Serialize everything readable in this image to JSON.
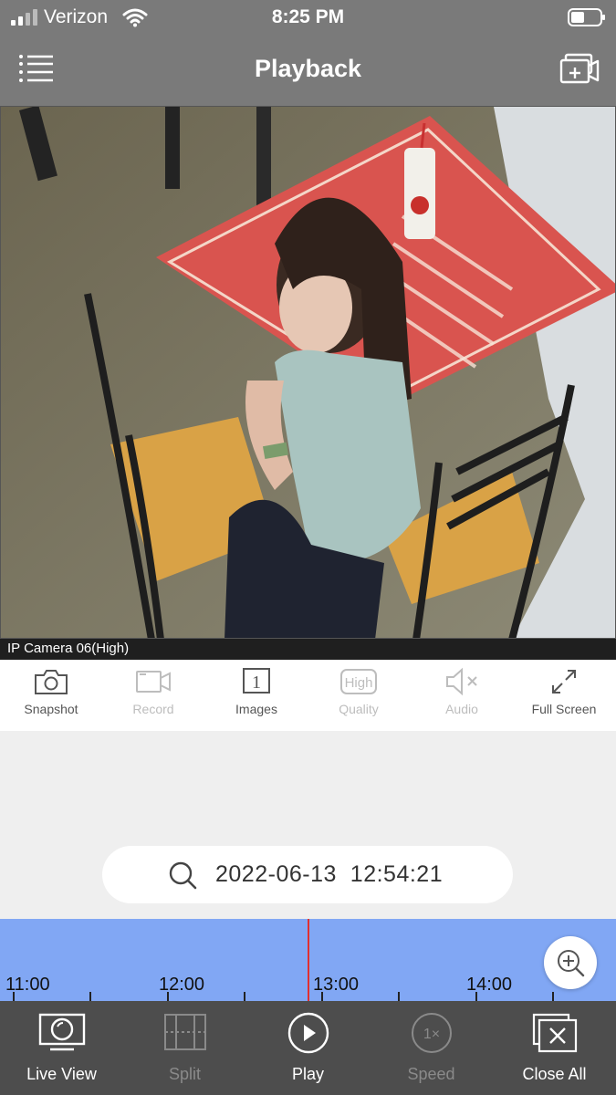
{
  "status_bar": {
    "carrier": "Verizon",
    "time": "8:25 PM"
  },
  "header": {
    "title": "Playback",
    "left_icon": "menu-icon",
    "right_icon": "add-camera-icon"
  },
  "video": {
    "camera_label": "IP Camera 06(High)"
  },
  "toolbar": {
    "items": [
      {
        "label": "Snapshot",
        "icon": "camera-icon",
        "enabled": true
      },
      {
        "label": "Record",
        "icon": "video-record-icon",
        "enabled": false
      },
      {
        "label": "Images",
        "icon": "images-icon",
        "badge": "1",
        "enabled": true
      },
      {
        "label": "Quality",
        "icon": "quality-icon",
        "badge": "High",
        "enabled": false
      },
      {
        "label": "Audio",
        "icon": "audio-muted-icon",
        "enabled": false
      },
      {
        "label": "Full Screen",
        "icon": "fullscreen-icon",
        "enabled": true
      }
    ]
  },
  "search": {
    "date": "2022-06-13",
    "time": "12:54:21"
  },
  "timeline": {
    "labels": [
      "11:00",
      "12:00",
      "13:00",
      "14:00"
    ],
    "playhead_time": "12:54:21"
  },
  "bottom_bar": {
    "items": [
      {
        "label": "Live View",
        "icon": "live-view-icon",
        "enabled": true
      },
      {
        "label": "Split",
        "icon": "split-icon",
        "enabled": false
      },
      {
        "label": "Play",
        "icon": "play-icon",
        "enabled": true
      },
      {
        "label": "Speed",
        "icon": "speed-icon",
        "badge": "1×",
        "enabled": false
      },
      {
        "label": "Close All",
        "icon": "close-all-icon",
        "enabled": true
      }
    ]
  },
  "colors": {
    "chrome": "#7a7a7a",
    "timeline": "#81a7f4",
    "playhead": "#e03030",
    "bottom_bar": "#4d4d4d"
  }
}
